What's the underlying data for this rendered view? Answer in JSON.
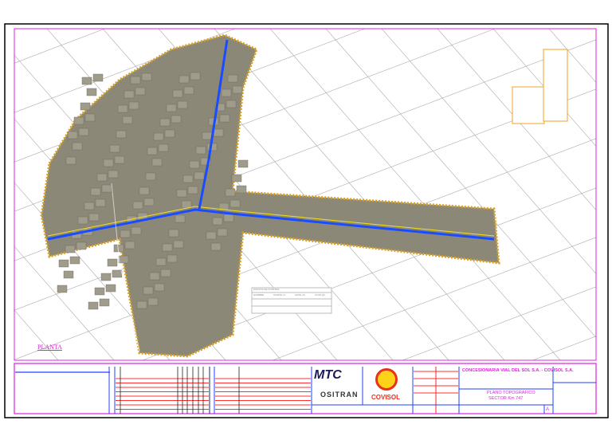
{
  "title_block": {
    "company": "CONCESIONARIA VIAL DEL SOL S.A. - COVISOL S.A.",
    "plan_title": "PLANO TOPOGRAFICO",
    "sector": "SECTOR Km 747",
    "revision": "A",
    "logos": {
      "mtc": "MTC",
      "ositran": "OSITRAN",
      "covisol": "COVISOL"
    }
  },
  "drawing": {
    "view_label": "PLANTA",
    "control_table_title": "PUNTOS DE CONTROL",
    "control_table_headers": [
      "NOMBRE",
      "NORTE (Y)",
      "ESTE (X)",
      "COTA (Z)"
    ]
  },
  "colors": {
    "frame": "#e020e0",
    "road": "#1a4cff",
    "terrain": "#8c8878",
    "contour": "#d9a020",
    "title_lines": "#ff2020"
  }
}
